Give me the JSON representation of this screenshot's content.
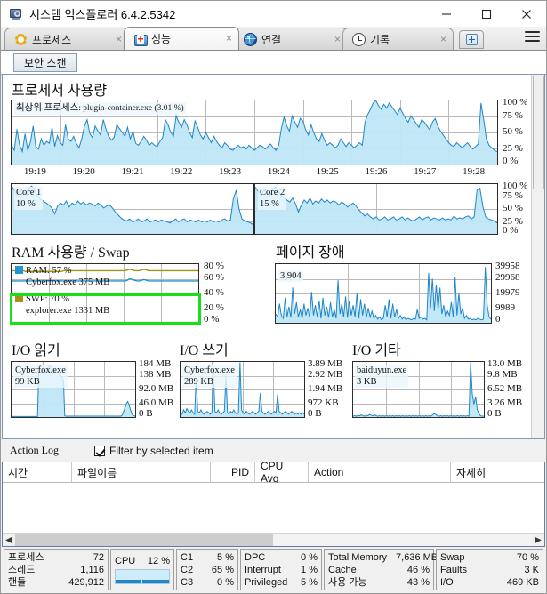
{
  "window": {
    "title": "시스템 익스플로러 6.4.2.5342",
    "icon": "system-explorer-icon",
    "minimize_label": "─",
    "maximize_label": "□",
    "close_label": "✕"
  },
  "tabs": [
    {
      "label": "프로세스",
      "icon": "gear-icon",
      "close": "×",
      "active": false
    },
    {
      "label": "성능",
      "icon": "performance-icon",
      "close": "×",
      "active": true
    },
    {
      "label": "연결",
      "icon": "globe-icon",
      "close": "×",
      "active": false
    },
    {
      "label": "기록",
      "icon": "clock-icon",
      "close": "×",
      "active": false
    }
  ],
  "tab_new_label": "+",
  "menu_icon": "hamburger-menu-icon",
  "toolbar": {
    "scan_label": "보안 스캔"
  },
  "chart_data": [
    {
      "id": "processor-usage",
      "type": "area",
      "title": "프로세서 사용량",
      "note": "최상위 프로세스: plugin-container.exe (3.01 %)",
      "note_primary": "최상위 프로세스",
      "note_secondary": ": plugin-container.exe (3.01 %)",
      "ylabels": [
        "100 %",
        "75 %",
        "50 %",
        "25 %",
        "0 %"
      ],
      "ylim": [
        0,
        100
      ],
      "xlabels": [
        "19:19",
        "19:20",
        "19:21",
        "19:22",
        "19:23",
        "19:24",
        "19:25",
        "19:26",
        "19:27",
        "19:28"
      ],
      "grid": true,
      "color": "#1f86c8",
      "fill": "#bfe6f7",
      "values": [
        30,
        22,
        55,
        30,
        20,
        48,
        22,
        35,
        60,
        28,
        24,
        40,
        30,
        36,
        33,
        58,
        28,
        45,
        34,
        30,
        62,
        40,
        36,
        44,
        33,
        26,
        40,
        60,
        70,
        48,
        42,
        60,
        52,
        46,
        70,
        55,
        44,
        38,
        42,
        62,
        56,
        50,
        44,
        58,
        40,
        52,
        33,
        30,
        36,
        44,
        38,
        30,
        34,
        30,
        28,
        36,
        42,
        70,
        62,
        50,
        44,
        76,
        66,
        58,
        70,
        62,
        50,
        42,
        68,
        58,
        46,
        40,
        50,
        42,
        34,
        44,
        36,
        30,
        26,
        34,
        30,
        24,
        22,
        26,
        30,
        26,
        28,
        24,
        30,
        26,
        22,
        26,
        30,
        28,
        24,
        28,
        32,
        26,
        22,
        30,
        56,
        74,
        60,
        52,
        76,
        66,
        58,
        72,
        68,
        54,
        46,
        62,
        50,
        40,
        36,
        48,
        38,
        30,
        34,
        30,
        26,
        30,
        40,
        34,
        28,
        34,
        30,
        26,
        30,
        34,
        30,
        66,
        78,
        86,
        96,
        100,
        92,
        86,
        94,
        88,
        96,
        90,
        84,
        78,
        88,
        80,
        72,
        66,
        76,
        70,
        64,
        58,
        70,
        66,
        60,
        54,
        66,
        72,
        60,
        52,
        46,
        40,
        34,
        30,
        28,
        34,
        30,
        26,
        30,
        34,
        28,
        24,
        28,
        32,
        96,
        70,
        40,
        30,
        26,
        22,
        20
      ]
    },
    {
      "id": "core-1",
      "type": "area",
      "label": "Core 1",
      "value": "10 %",
      "ylim": [
        0,
        100
      ],
      "color": "#1f86c8",
      "fill": "#bfe6f7",
      "values": [
        96,
        88,
        78,
        90,
        86,
        78,
        92,
        96,
        88,
        76,
        70,
        66,
        62,
        58,
        52,
        40,
        56,
        62,
        58,
        66,
        54,
        62,
        58,
        66,
        60,
        64,
        58,
        62,
        60,
        56,
        62,
        58,
        52,
        56,
        58,
        52,
        44,
        38,
        32,
        28,
        26,
        30,
        24,
        26,
        30,
        24,
        26,
        30,
        24,
        26,
        28,
        24,
        28,
        26,
        24,
        22,
        26,
        30,
        24,
        28,
        30,
        24,
        28,
        26,
        24,
        28,
        24,
        26,
        24,
        28,
        24,
        26,
        24,
        28,
        30,
        26,
        28,
        70,
        88,
        50,
        30,
        26,
        24,
        22,
        18
      ]
    },
    {
      "id": "core-2",
      "type": "area",
      "label": "Core 2",
      "value": "15 %",
      "ylim": [
        0,
        100
      ],
      "color": "#1f86c8",
      "fill": "#bfe6f7",
      "values": [
        94,
        86,
        76,
        88,
        84,
        76,
        90,
        94,
        86,
        78,
        72,
        68,
        64,
        72,
        60,
        44,
        58,
        68,
        62,
        72,
        60,
        66,
        62,
        70,
        64,
        68,
        62,
        66,
        64,
        58,
        64,
        60,
        54,
        58,
        62,
        56,
        48,
        42,
        36,
        40,
        34,
        30,
        34,
        28,
        30,
        34,
        28,
        30,
        34,
        28,
        30,
        34,
        28,
        32,
        28,
        26,
        30,
        34,
        28,
        32,
        34,
        28,
        32,
        30,
        28,
        32,
        28,
        30,
        28,
        36,
        30,
        32,
        30,
        34,
        36,
        30,
        34,
        88,
        92,
        56,
        34,
        30,
        28,
        26,
        22
      ]
    },
    {
      "id": "ram-swap",
      "type": "line",
      "title": "RAM 사용량 / Swap",
      "ylabels": [
        "80 %",
        "60 %",
        "40 %",
        "20 %",
        "0 %"
      ],
      "ylim": [
        0,
        80
      ],
      "grid": true,
      "legend": [
        {
          "name": "RAM: 57 %",
          "swatch": "#2196d6",
          "line_color": "#2196d6",
          "sub": "Cyberfox.exe 375 MB"
        },
        {
          "name": "SWP: 70 %",
          "swatch": "#a39216",
          "line_color": "#a39216",
          "sub": "explorer.exe 1331 MB"
        }
      ],
      "highlight_group": "SWP",
      "highlight_color": "#18e018",
      "series": [
        {
          "name": "SWP",
          "color": "#a39216",
          "values": [
            71,
            71,
            71,
            71,
            71,
            71,
            70,
            70,
            70,
            70,
            70,
            70,
            70,
            70,
            70,
            70,
            70,
            70,
            70,
            70,
            70,
            70,
            71,
            71,
            71,
            71,
            71,
            71,
            71,
            71,
            71,
            71,
            71,
            71,
            71,
            71,
            71,
            71,
            71,
            71,
            71,
            71,
            71,
            71,
            71,
            71,
            71,
            71,
            71,
            72,
            73,
            72,
            71,
            71,
            71,
            72,
            73,
            72,
            71,
            71,
            71,
            71,
            71,
            71,
            71,
            71,
            71,
            71,
            71,
            71,
            71,
            71,
            71,
            71,
            71,
            71,
            71,
            71,
            71,
            71
          ]
        },
        {
          "name": "RAM",
          "color": "#2196d6",
          "values": [
            57,
            57,
            57,
            57,
            57,
            57,
            57,
            57,
            57,
            57,
            57,
            57,
            57,
            57,
            57,
            57,
            57,
            57,
            57,
            57,
            57,
            57,
            57,
            57,
            57,
            57,
            57,
            57,
            57,
            57,
            57,
            57,
            57,
            57,
            57,
            57,
            57,
            57,
            57,
            57,
            57,
            57,
            57,
            57,
            57,
            57,
            57,
            57,
            57,
            58,
            60,
            59,
            58,
            57,
            57,
            58,
            59,
            58,
            57,
            57,
            57,
            57,
            57,
            57,
            57,
            57,
            57,
            57,
            57,
            57,
            57,
            57,
            57,
            57,
            57,
            57,
            57,
            57,
            57,
            57
          ]
        }
      ]
    },
    {
      "id": "page-faults",
      "type": "area",
      "title": "페이지 장애",
      "note": "3,904",
      "ylabels": [
        "39958",
        "29968",
        "19979",
        "9989",
        "0"
      ],
      "ylim": [
        0,
        39958
      ],
      "grid": true,
      "color": "#1f86c8",
      "fill": "#bfe6f7",
      "values": [
        6000,
        4000,
        13000,
        5000,
        3000,
        17000,
        4000,
        11000,
        3500,
        24000,
        6000,
        14000,
        4000,
        9000,
        3000,
        13000,
        5000,
        10000,
        3500,
        21000,
        5000,
        12000,
        4000,
        15000,
        3000,
        17000,
        5000,
        11000,
        3500,
        14000,
        4000,
        9000,
        3000,
        29000,
        6000,
        13000,
        4000,
        18000,
        3500,
        15000,
        5000,
        12000,
        4000,
        20000,
        3000,
        16000,
        5000,
        13000,
        3500,
        10000,
        4000,
        8000,
        3000,
        5000,
        2500,
        4000,
        2000,
        3000,
        12000,
        4000,
        16000,
        3000,
        13000,
        4000,
        9000,
        3000,
        5000,
        2500,
        4000,
        2000,
        3000,
        2500,
        2000,
        3000,
        2500,
        9000,
        3000,
        4000,
        2500,
        3000,
        2000,
        34000,
        10000,
        30000,
        8000,
        26000,
        9000,
        24000,
        6000,
        12000,
        4000,
        8000,
        5000,
        14000,
        4000,
        31000,
        5000,
        20000,
        6000,
        10000,
        3000,
        5000,
        2500,
        3000,
        2000,
        2500,
        2000,
        3000,
        2500,
        2000,
        2500,
        38000,
        12000,
        4000,
        2500
      ]
    },
    {
      "id": "io-read",
      "type": "area",
      "title": "I/O 읽기",
      "note_line1": "Cyberfox.exe",
      "note_line2": "99 KB",
      "ylabels": [
        "184 MB",
        "138 MB",
        "92.0 MB",
        "46.0 MB",
        "0 B"
      ],
      "ylim": [
        0,
        184
      ],
      "grid": true,
      "color": "#1f86c8",
      "fill": "#bfe6f7",
      "values": [
        2,
        2,
        2,
        2,
        2,
        2,
        2,
        2,
        2,
        2,
        2,
        2,
        2,
        2,
        2,
        2,
        2,
        2,
        2,
        2,
        2,
        2,
        148,
        150,
        150,
        152,
        150,
        151,
        153,
        160,
        168,
        172,
        166,
        158,
        162,
        156,
        150,
        152,
        148,
        150,
        138,
        130,
        122,
        4,
        3,
        3,
        3,
        3,
        3,
        3,
        3,
        3,
        3,
        3,
        3,
        3,
        3,
        3,
        3,
        3,
        3,
        3,
        3,
        3,
        3,
        3,
        3,
        3,
        3,
        3,
        3,
        3,
        3,
        3,
        3,
        3,
        3,
        3,
        3,
        3,
        3,
        3,
        3,
        3,
        3,
        3,
        3,
        3,
        3,
        4,
        10,
        22,
        34,
        46,
        52,
        40,
        26,
        14,
        6,
        4,
        3
      ]
    },
    {
      "id": "io-write",
      "type": "area",
      "title": "I/O 쓰기",
      "note_line1": "Cyberfox.exe",
      "note_line2": "289 KB",
      "ylabels": [
        "3.89 MB",
        "2.92 MB",
        "1.94 MB",
        "972 KB",
        "0 B"
      ],
      "ylim": [
        0,
        3.89
      ],
      "grid": true,
      "color": "#1f86c8",
      "fill": "#bfe6f7",
      "values": [
        0.3,
        0.2,
        0.5,
        0.3,
        0.6,
        0.4,
        0.3,
        0.5,
        0.3,
        0.2,
        2.8,
        0.4,
        0.3,
        0.5,
        0.3,
        0.2,
        0.3,
        0.4,
        0.3,
        0.2,
        0.3,
        3.2,
        0.4,
        0.3,
        0.5,
        0.3,
        0.2,
        0.3,
        0.4,
        2.9,
        0.3,
        0.2,
        0.4,
        0.3,
        0.5,
        0.3,
        0.2,
        0.3,
        3.85,
        0.5,
        0.3,
        0.2,
        0.4,
        0.3,
        0.2,
        0.3,
        0.4,
        0.3,
        0.2,
        0.3,
        0.4,
        1.7,
        0.4,
        0.3,
        0.2,
        0.3,
        0.4,
        0.3,
        0.2,
        0.3,
        0.4,
        0.3,
        1.6,
        0.4,
        0.3,
        0.2,
        0.3,
        0.4,
        0.3,
        0.2,
        0.3,
        0.4,
        0.3,
        0.2,
        0.3,
        0.2,
        0.3,
        0.2,
        0.3,
        0.2
      ]
    },
    {
      "id": "io-other",
      "type": "area",
      "title": "I/O 기타",
      "note_line1": "baiduyun.exe",
      "note_line2": "3 KB",
      "ylabels": [
        "13.0 MB",
        "9.8 MB",
        "6.52 MB",
        "3.26 MB",
        "0 B"
      ],
      "ylim": [
        0,
        13.0
      ],
      "grid": true,
      "color": "#1f86c8",
      "fill": "#bfe6f7",
      "values": [
        0.2,
        0.3,
        0.2,
        0.4,
        0.3,
        0.5,
        0.3,
        0.2,
        0.4,
        0.3,
        0.6,
        0.4,
        0.3,
        0.5,
        0.3,
        0.2,
        0.3,
        0.2,
        0.3,
        0.2,
        0.3,
        0.2,
        0.3,
        0.2,
        0.3,
        0.2,
        0.3,
        0.2,
        0.3,
        0.2,
        0.3,
        0.2,
        0.3,
        0.2,
        0.3,
        0.2,
        0.3,
        0.2,
        0.3,
        0.2,
        0.3,
        0.2,
        0.3,
        0.2,
        0.3,
        0.2,
        0.3,
        0.2,
        0.5,
        0.8,
        0.6,
        0.3,
        0.2,
        0.3,
        0.2,
        0.3,
        0.2,
        0.3,
        0.2,
        0.3,
        0.2,
        0.3,
        0.2,
        0.3,
        0.2,
        0.3,
        0.2,
        0.3,
        0.2,
        0.3,
        0.2,
        12.9,
        5.5,
        3.0,
        4.8,
        1.8,
        0.8,
        0.3,
        0.2,
        0.2
      ]
    }
  ],
  "action_log": {
    "title": "Action Log",
    "filter_label": "Filter by selected item",
    "filter_checked": true,
    "columns": [
      "시간",
      "파일이름",
      "PID",
      "CPU Avg",
      "Action",
      "자세히"
    ],
    "rows": []
  },
  "statusbar": {
    "groups": [
      {
        "rows": [
          {
            "key": "프로세스",
            "value": "72"
          },
          {
            "key": "스레드",
            "value": "1,116"
          },
          {
            "key": "핸들",
            "value": "429,912"
          }
        ]
      },
      {
        "cpu_key": "CPU",
        "cpu_value": "12 %",
        "cpu_bar_percent": 12
      },
      {
        "rows": [
          {
            "key": "C1",
            "value": "5 %"
          },
          {
            "key": "C2",
            "value": "65 %"
          },
          {
            "key": "C3",
            "value": "0 %"
          }
        ]
      },
      {
        "rows": [
          {
            "key": "DPC",
            "value": "0 %"
          },
          {
            "key": "Interrupt",
            "value": "1 %"
          },
          {
            "key": "Privileged",
            "value": "5 %"
          }
        ]
      },
      {
        "rows": [
          {
            "key": "Total Memory",
            "value": "7,636 MB"
          },
          {
            "key": "Cache",
            "value": "46 %"
          },
          {
            "key": "사용 가능",
            "value": "43 %"
          }
        ]
      },
      {
        "rows": [
          {
            "key": "Swap",
            "value": "70 %"
          },
          {
            "key": "Faults",
            "value": "3 K"
          },
          {
            "key": "I/O",
            "value": "469 KB"
          }
        ]
      }
    ]
  },
  "scrollbars": {
    "hscroll_left": "◀",
    "hscroll_right": "▶"
  }
}
